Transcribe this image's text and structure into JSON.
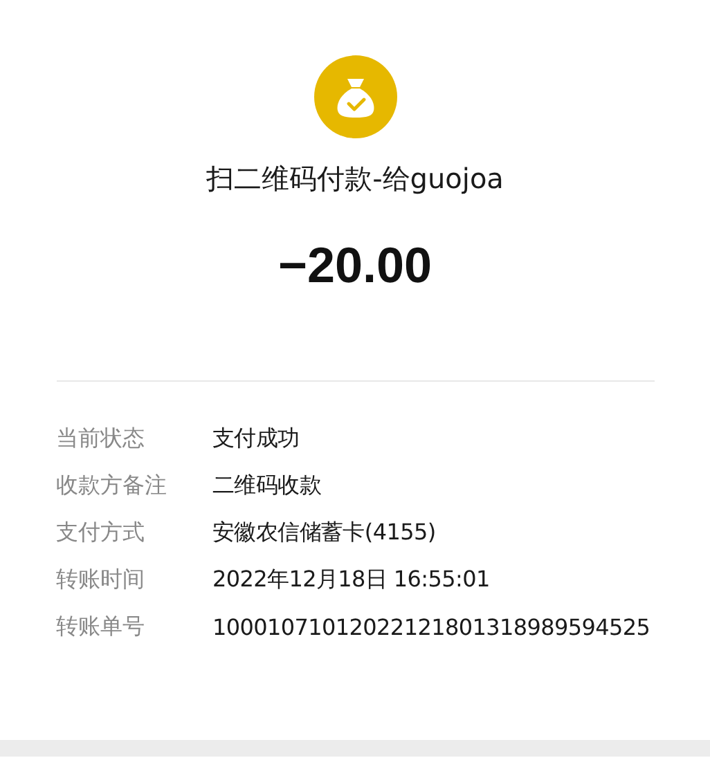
{
  "title": "扫二维码付款-给guojoa",
  "amount": "−20.00",
  "details": [
    {
      "label": "当前状态",
      "value": "支付成功"
    },
    {
      "label": "收款方备注",
      "value": "二维码收款"
    },
    {
      "label": "支付方式",
      "value": "安徽农信储蓄卡(4155)"
    },
    {
      "label": "转账时间",
      "value": "2022年12月18日 16:55:01"
    },
    {
      "label": "转账单号",
      "value": "10001071012022121801318989594525"
    }
  ]
}
